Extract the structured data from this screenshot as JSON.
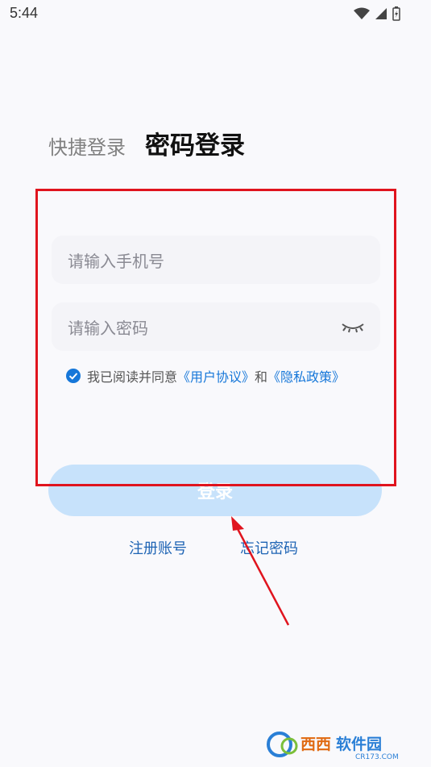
{
  "status_bar": {
    "time": "5:44",
    "icons": [
      "wifi-icon",
      "signal-icon",
      "battery-icon"
    ]
  },
  "tabs": {
    "quick_login": "快捷登录",
    "password_login": "密码登录"
  },
  "form": {
    "phone_placeholder": "请输入手机号",
    "password_placeholder": "请输入密码",
    "agreement_prefix": "我已阅读并同意",
    "user_agreement": "《用户协议》",
    "and": "和",
    "privacy_policy": "《隐私政策》",
    "login_button": "登录"
  },
  "links": {
    "register": "注册账号",
    "forgot_password": "忘记密码"
  },
  "colors": {
    "accent": "#1677d9",
    "button_bg": "#c7e2fb",
    "annotation": "#e0141e"
  },
  "watermark": {
    "text": "西西软件园",
    "sub": "CR173.COM"
  }
}
